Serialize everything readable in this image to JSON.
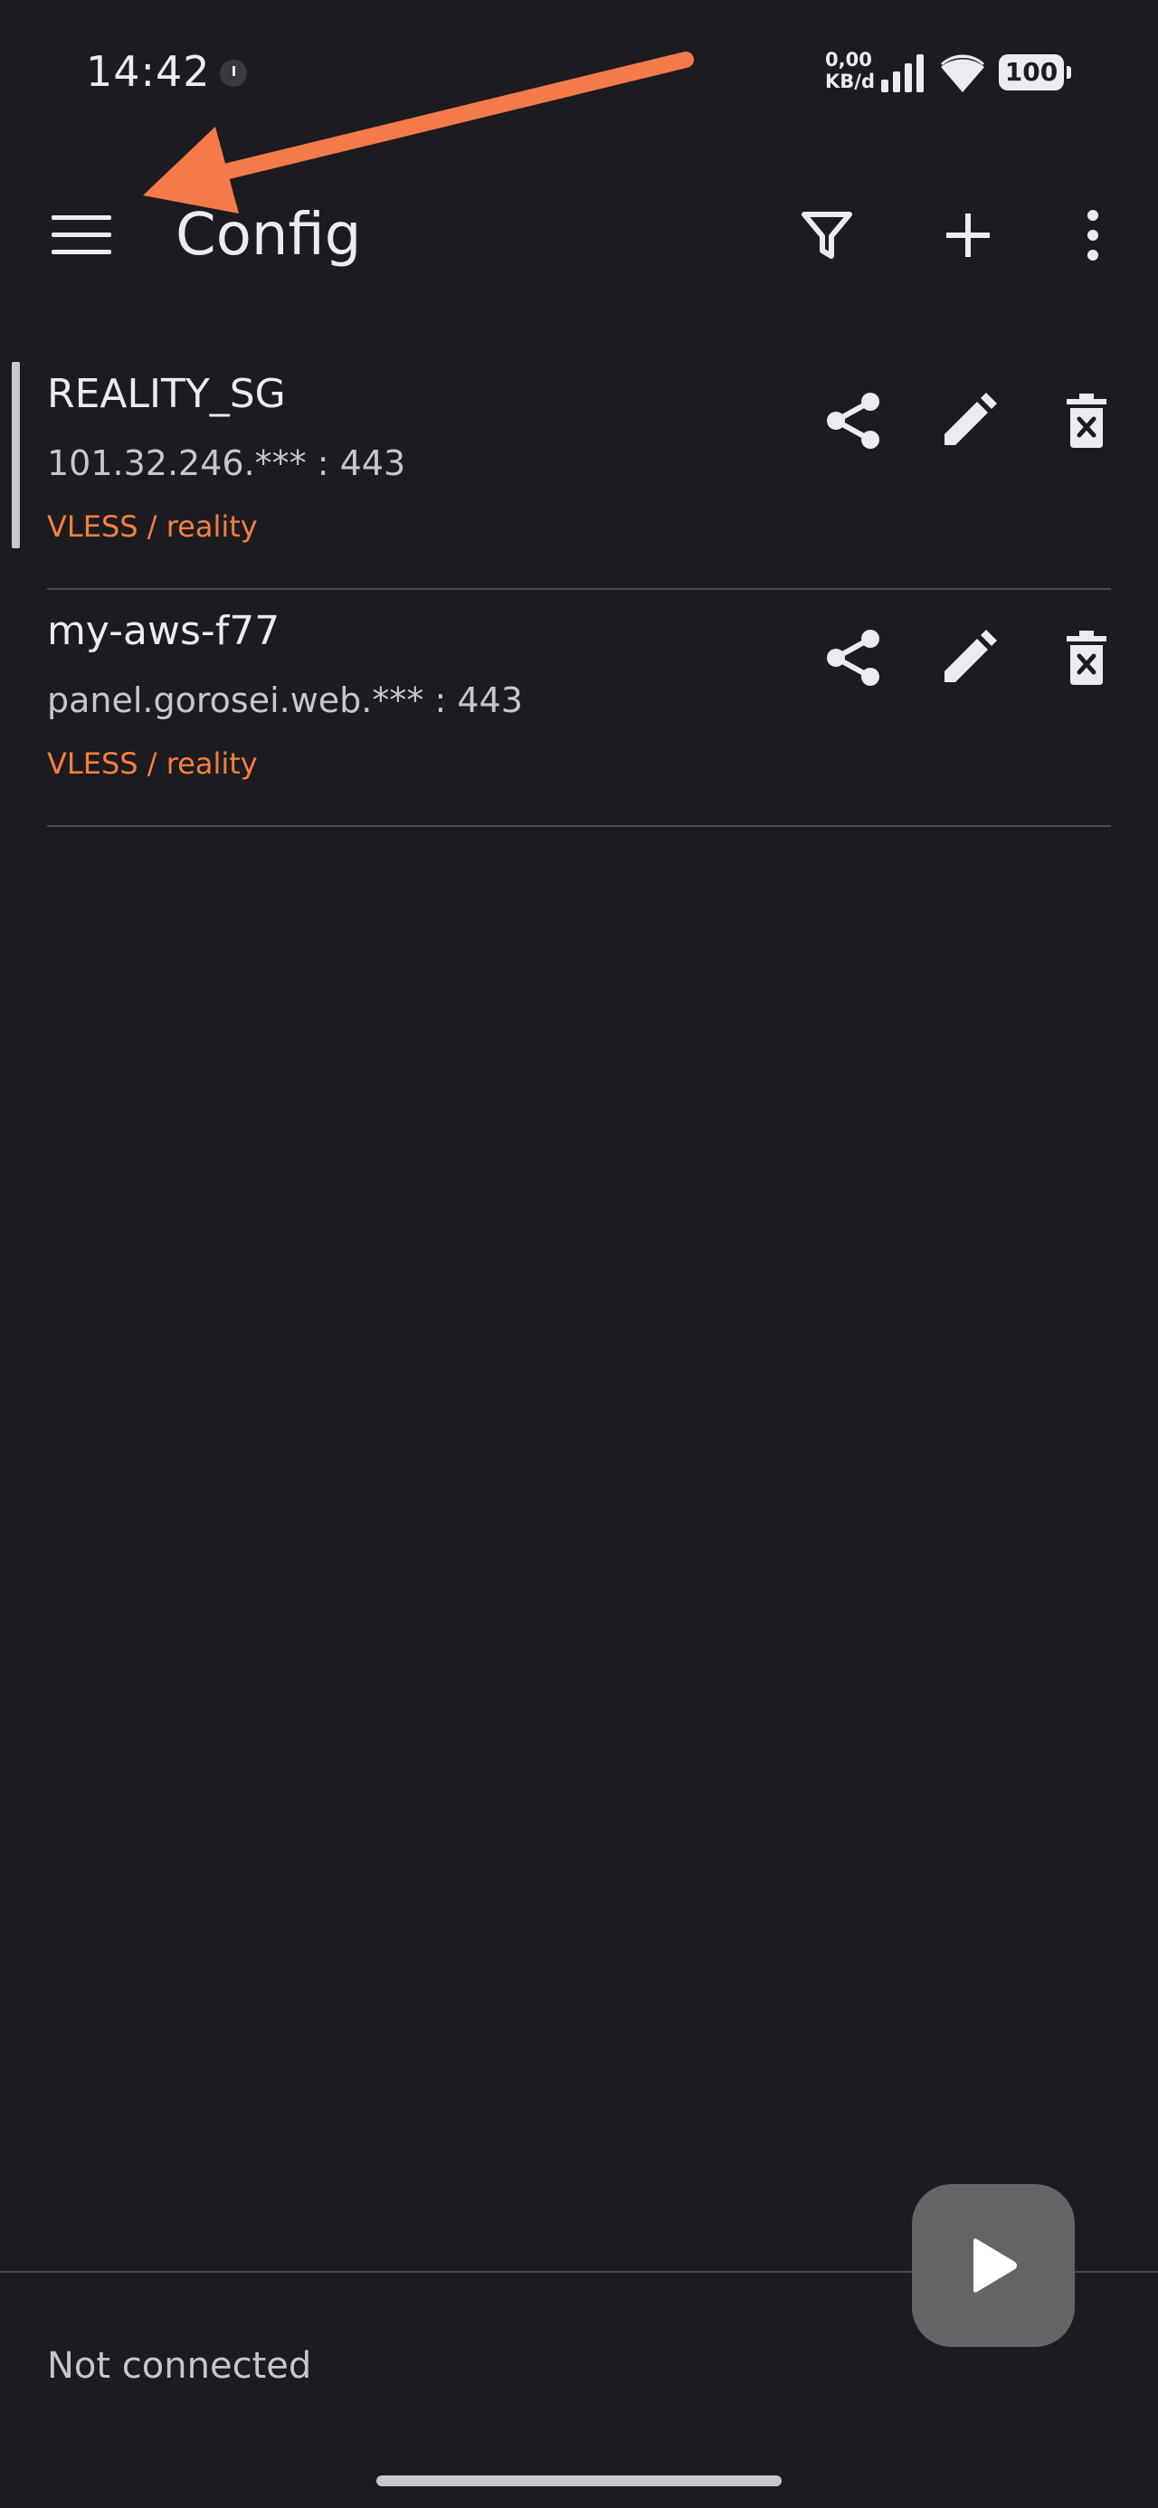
{
  "status_bar": {
    "time": "14:42",
    "speed_value": "0,00",
    "speed_unit": "KB/d",
    "battery": "100"
  },
  "app_bar": {
    "title": "Config"
  },
  "icons": {
    "menu": "hamburger-menu-icon",
    "filter": "filter-icon",
    "add": "plus-icon",
    "more": "more-vertical-icon",
    "share": "share-icon",
    "edit": "pencil-icon",
    "delete": "trash-icon",
    "play": "play-icon"
  },
  "colors": {
    "background": "#1c1b20",
    "accent": "#f5803e",
    "fab": "#646466"
  },
  "configs": [
    {
      "name": "REALITY_SG",
      "address": "101.32.246.*** : 443",
      "protocol": "VLESS / reality",
      "selected": true
    },
    {
      "name": "my-aws-f77",
      "address": "panel.gorosei.web.*** : 443",
      "protocol": "VLESS / reality",
      "selected": false
    }
  ],
  "footer": {
    "connection_status": "Not connected"
  }
}
